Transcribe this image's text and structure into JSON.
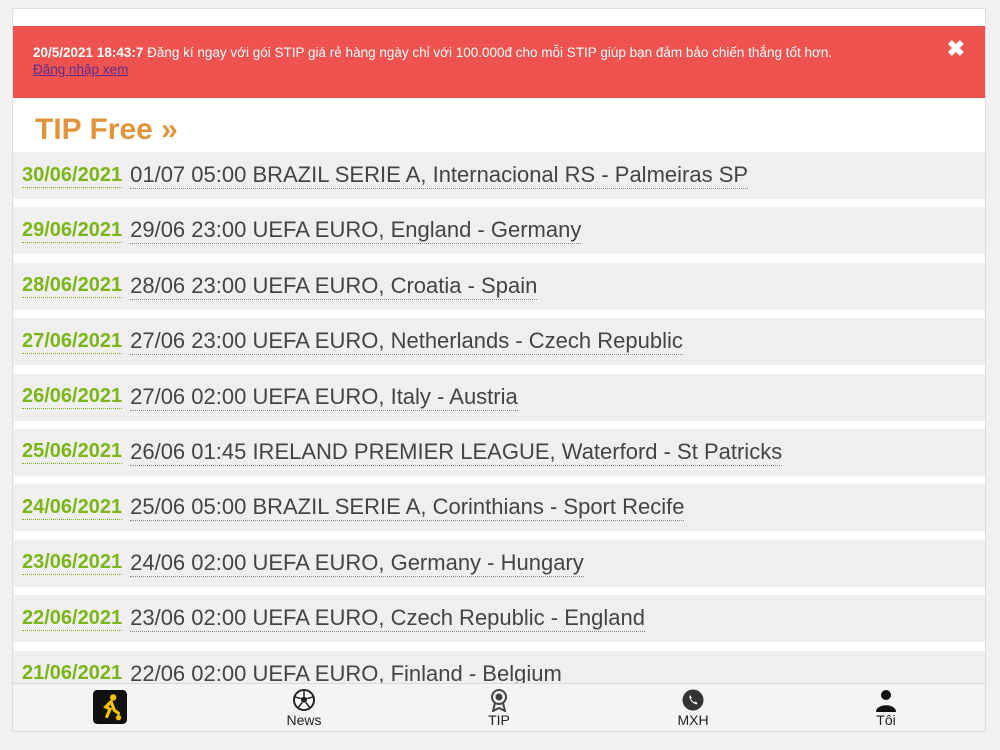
{
  "alert": {
    "date": "20/5/2021 18:43:7",
    "message": "Đăng kí ngay với gói STIP giá rẻ hàng ngày chỉ với 100.000đ cho mỗi STIP giúp bạn đảm bảo chiến thắng tốt hơn.",
    "link": "Đăng nhập xem",
    "close": "✖"
  },
  "title": "TIP Free »",
  "tips": [
    {
      "date": "30/06/2021",
      "text": "01/07 05:00 BRAZIL SERIE A, Internacional RS - Palmeiras SP"
    },
    {
      "date": "29/06/2021",
      "text": "29/06 23:00 UEFA EURO, England - Germany"
    },
    {
      "date": "28/06/2021",
      "text": "28/06 23:00 UEFA EURO, Croatia - Spain"
    },
    {
      "date": "27/06/2021",
      "text": "27/06 23:00 UEFA EURO, Netherlands - Czech Republic"
    },
    {
      "date": "26/06/2021",
      "text": "27/06 02:00 UEFA EURO, Italy - Austria"
    },
    {
      "date": "25/06/2021",
      "text": "26/06 01:45 IRELAND PREMIER LEAGUE, Waterford - St Patricks"
    },
    {
      "date": "24/06/2021",
      "text": "25/06 05:00 BRAZIL SERIE A, Corinthians - Sport Recife"
    },
    {
      "date": "23/06/2021",
      "text": "24/06 02:00 UEFA EURO, Germany - Hungary"
    },
    {
      "date": "22/06/2021",
      "text": "23/06 02:00 UEFA EURO, Czech Republic - England"
    },
    {
      "date": "21/06/2021",
      "text": "22/06 02:00 UEFA EURO, Finland - Belgium"
    }
  ],
  "nav": {
    "home_icon": "soccer-player-icon",
    "news": "News",
    "tip": "TIP",
    "mxh": "MXH",
    "toi": "Tôi"
  },
  "colors": {
    "alert_bg": "#ef5350",
    "title": "#e0953c",
    "date": "#7cb518"
  }
}
